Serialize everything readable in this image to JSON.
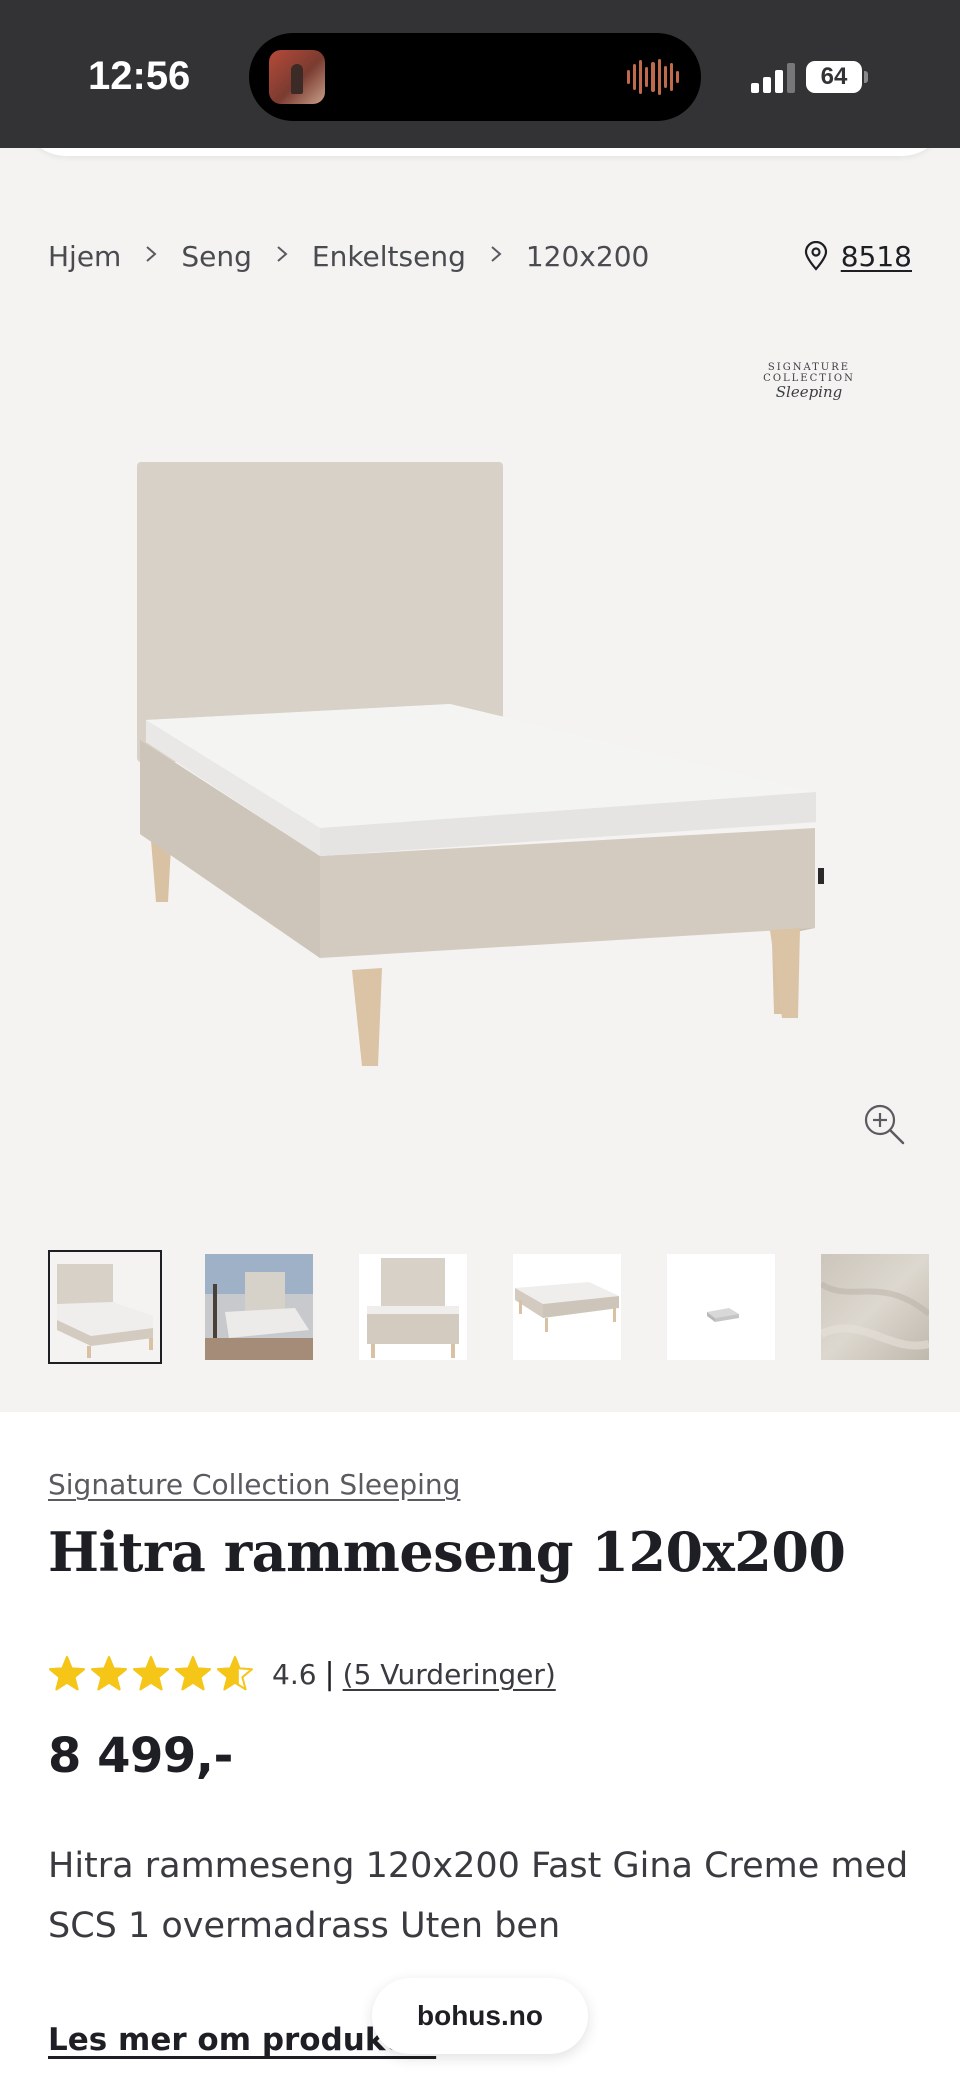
{
  "status_bar": {
    "time": "12:56",
    "battery": "64"
  },
  "breadcrumb": {
    "items": [
      "Hjem",
      "Seng",
      "Enkeltseng",
      "120x200"
    ],
    "separator": ">"
  },
  "store": {
    "number": "8518",
    "icon": "location-pin-icon"
  },
  "brand_logo": {
    "line1": "SIGNATURE COLLECTION",
    "line2": "Sleeping"
  },
  "product": {
    "brand": "Signature Collection Sleeping",
    "title": "Hitra rammeseng 120x200",
    "rating_value": "4.6",
    "rating_separator": "|",
    "rating_count": "(5 Vurderinger)",
    "rating_stars": 4.6,
    "rating_max": 5,
    "price": "8 499,-",
    "description": "Hitra rammeseng 120x200 Fast Gina Creme med SCS 1 overmadrass Uten ben",
    "read_more": "Les mer om produktet"
  },
  "gallery": {
    "thumbnail_count": 6,
    "selected_index": 0
  },
  "browser": {
    "url": "bohus.no"
  },
  "colors": {
    "star": "#f5c518",
    "text": "#1e1f24",
    "background_gray": "#f4f3f1",
    "status_bar": "#333335"
  }
}
